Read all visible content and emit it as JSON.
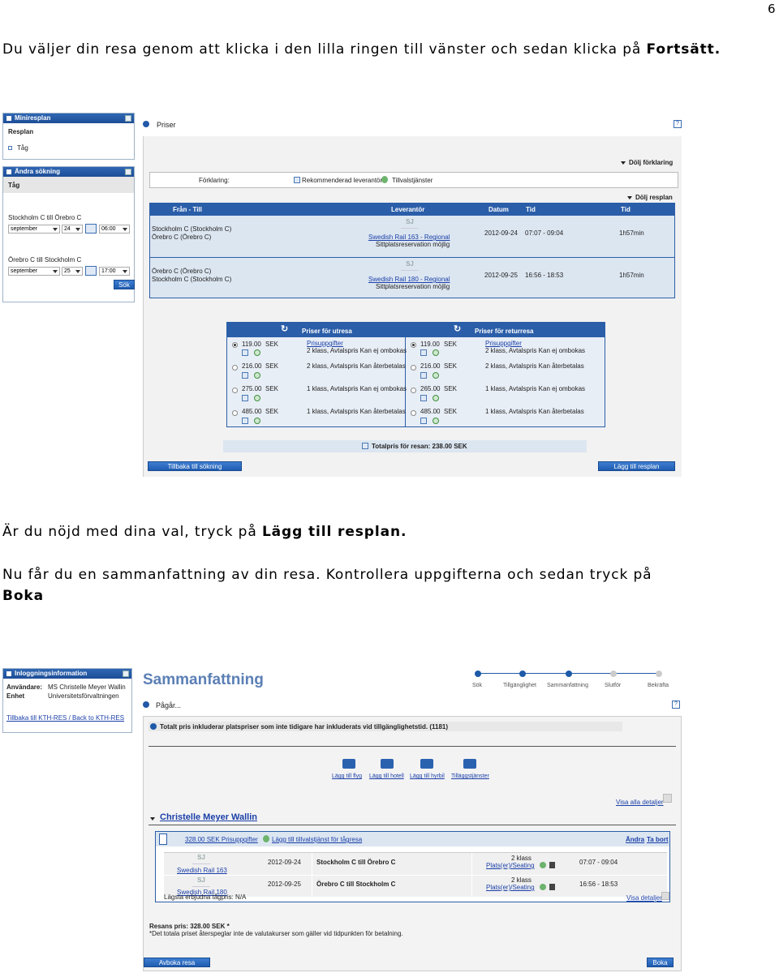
{
  "page_number": "6",
  "intro": {
    "prefix": "Du väljer din resa genom att klicka i den lilla ringen till vänster och sedan klicka på ",
    "bold": "Fortsätt."
  },
  "shot1": {
    "mini": {
      "title": "Miniresplan",
      "item1": "Resplan",
      "item2": "Tåg"
    },
    "search": {
      "title": "Ändra sökning",
      "tag": "Tåg",
      "route1": "Stockholm C till Örebro C",
      "month1": "september",
      "day1": "24",
      "time1": "06:00",
      "route2": "Örebro C till Stockholm C",
      "month2": "september",
      "day2": "25",
      "time2": "17:00",
      "button": "Sök"
    },
    "priser": {
      "title": "Priser",
      "help": "?"
    },
    "legend": {
      "toggle": "Dölj förklaring",
      "label": "Förklaring:",
      "item1": "Rekommenderad leverantör",
      "item2": "Tillvalstjänster"
    },
    "itinerary": {
      "toggle": "Dölj resplan",
      "headers": [
        "Från - Till",
        "Leverantör",
        "Datum",
        "Tid",
        "Tid"
      ],
      "rows": [
        {
          "from": "Stockholm C (Stockholm C)",
          "to": "Örebro C (Örebro C)",
          "supplier": "Swedish Rail   163 - Regional",
          "note": "Sittplatsreservation möjlig",
          "date": "2012-09-24",
          "time": "07:07 - 09:04",
          "duration": "1h57min"
        },
        {
          "from": "Örebro C (Örebro C)",
          "to": "Stockholm C (Stockholm C)",
          "supplier": "Swedish Rail   180 - Regional",
          "note": "Sittplatsreservation möjlig",
          "date": "2012-09-25",
          "time": "16:56 - 18:53",
          "duration": "1h57min"
        }
      ]
    },
    "prices": {
      "out_title": "Priser för utresa",
      "ret_title": "Priser för returresa",
      "out": [
        {
          "price": "119.00",
          "cur": "SEK",
          "desc1": "Prisuppgifter",
          "desc2": "2 klass, Avtalspris Kan ej ombokas",
          "selected": true
        },
        {
          "price": "216.00",
          "cur": "SEK",
          "desc1": "2 klass, Avtalspris Kan återbetalas",
          "desc2": "",
          "selected": false
        },
        {
          "price": "275.00",
          "cur": "SEK",
          "desc1": "1 klass, Avtalspris Kan ej ombokas",
          "desc2": "",
          "selected": false
        },
        {
          "price": "485.00",
          "cur": "SEK",
          "desc1": "1 klass, Avtalspris Kan återbetalas",
          "desc2": "",
          "selected": false
        }
      ],
      "ret": [
        {
          "price": "119.00",
          "cur": "SEK",
          "desc1": "Prisuppgifter",
          "desc2": "2 klass, Avtalspris Kan ej ombokas",
          "selected": true
        },
        {
          "price": "216.00",
          "cur": "SEK",
          "desc1": "2 klass, Avtalspris Kan återbetalas",
          "desc2": "",
          "selected": false
        },
        {
          "price": "265.00",
          "cur": "SEK",
          "desc1": "1 klass, Avtalspris Kan ej ombokas",
          "desc2": "",
          "selected": false
        },
        {
          "price": "485.00",
          "cur": "SEK",
          "desc1": "1 klass, Avtalspris Kan återbetalas",
          "desc2": "",
          "selected": false
        }
      ],
      "total": "Totalpris för resan: 238.00 SEK"
    },
    "back_button": "Tillbaka till sökning",
    "add_button": "Lägg till resplan"
  },
  "para2": {
    "prefix": "Är du nöjd med dina val, tryck på ",
    "bold": "Lägg till resplan."
  },
  "para3": {
    "line1": "Nu får du en sammanfattning av din resa. Kontrollera uppgifterna och sedan tryck på",
    "bold": "Boka"
  },
  "shot2": {
    "login": {
      "title": "Inloggningsinformation",
      "user_label": "Användare:",
      "user": "MS Christelle Meyer Wallin",
      "unit_label": "Enhet",
      "unit": "Universitetsförvaltningen",
      "back_link": "Tillbaka till KTH-RES / Back to KTH-RES"
    },
    "heading": "Sammanfattning",
    "steps": [
      "Sök",
      "Tillgänglighet",
      "Sammanfattning",
      "Slutför",
      "Bekräfta"
    ],
    "status": "Pågår...",
    "help": "?",
    "info": "Totalt pris inkluderar platspriser som inte tidigare har inkluderats vid tillgänglighetstid. (1181)",
    "actions": [
      "Lägg till flyg",
      "Lägg till hotell",
      "Lägg till hyrbil",
      "Tilläggstjänster"
    ],
    "show_all": "Visa alla detaljer",
    "traveller": "Christelle Meyer Wallin",
    "trip": {
      "price": "328.00 SEK Prisuppgifter",
      "addon": "Lägg till tillvalstjänst för tågresa",
      "change": "Ändra",
      "remove": "Ta bort",
      "rows": [
        {
          "supplier": "Swedish Rail   163",
          "date": "2012-09-24",
          "route": "Stockholm C till Örebro C",
          "cls": "2 klass",
          "seat": "Plats(er)/Seating",
          "time": "07:07 - 09:04"
        },
        {
          "supplier": "Swedish Rail   180",
          "date": "2012-09-25",
          "route": "Örebro C till Stockholm C",
          "cls": "2 klass",
          "seat": "Plats(er)/Seating",
          "time": "16:56 - 18:53"
        }
      ],
      "lowest": "Lägsta erbjudna tågpris:  N/A",
      "details": "Visa detaljer"
    },
    "total1": "Resans pris: 328.00 SEK *",
    "total2": "*Det totala priset återspeglar inte de valutakurser som gäller vid tidpunkten för betalning.",
    "cancel_button": "Avboka resa",
    "book_button": "Boka"
  }
}
